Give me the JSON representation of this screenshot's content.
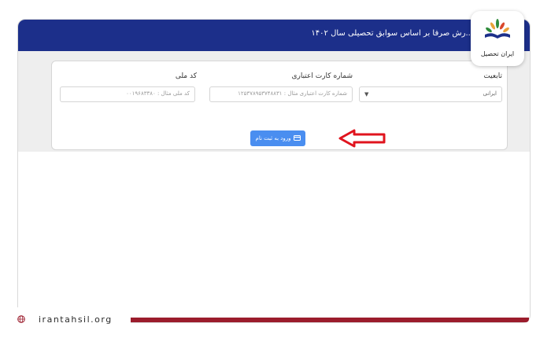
{
  "header": {
    "title": "...رش صرفا بر اساس سوابق تحصیلی سال ۱۴۰۲"
  },
  "form": {
    "nationality": {
      "label": "تابعیت",
      "value": "ایرانی"
    },
    "card_number": {
      "label": "شماره کارت اعتباری",
      "placeholder": "شماره کارت اعتباری مثال : ۱۲۵۳۷۸۹۵۳۷۴۸۸۳۱"
    },
    "national_code": {
      "label": "کد ملی",
      "placeholder": "کد ملی مثال : ۰۰۱۹۶۸۳۳۸۰"
    },
    "submit_label": "ورود به ثبت نام"
  },
  "brand": {
    "name": "ایران تحصیل",
    "url": "irantahsil.org"
  },
  "colors": {
    "header": "#1c2f8a",
    "button": "#4a8ef0",
    "arrow": "#e0141e",
    "footer_bar": "#9b1c2c"
  }
}
